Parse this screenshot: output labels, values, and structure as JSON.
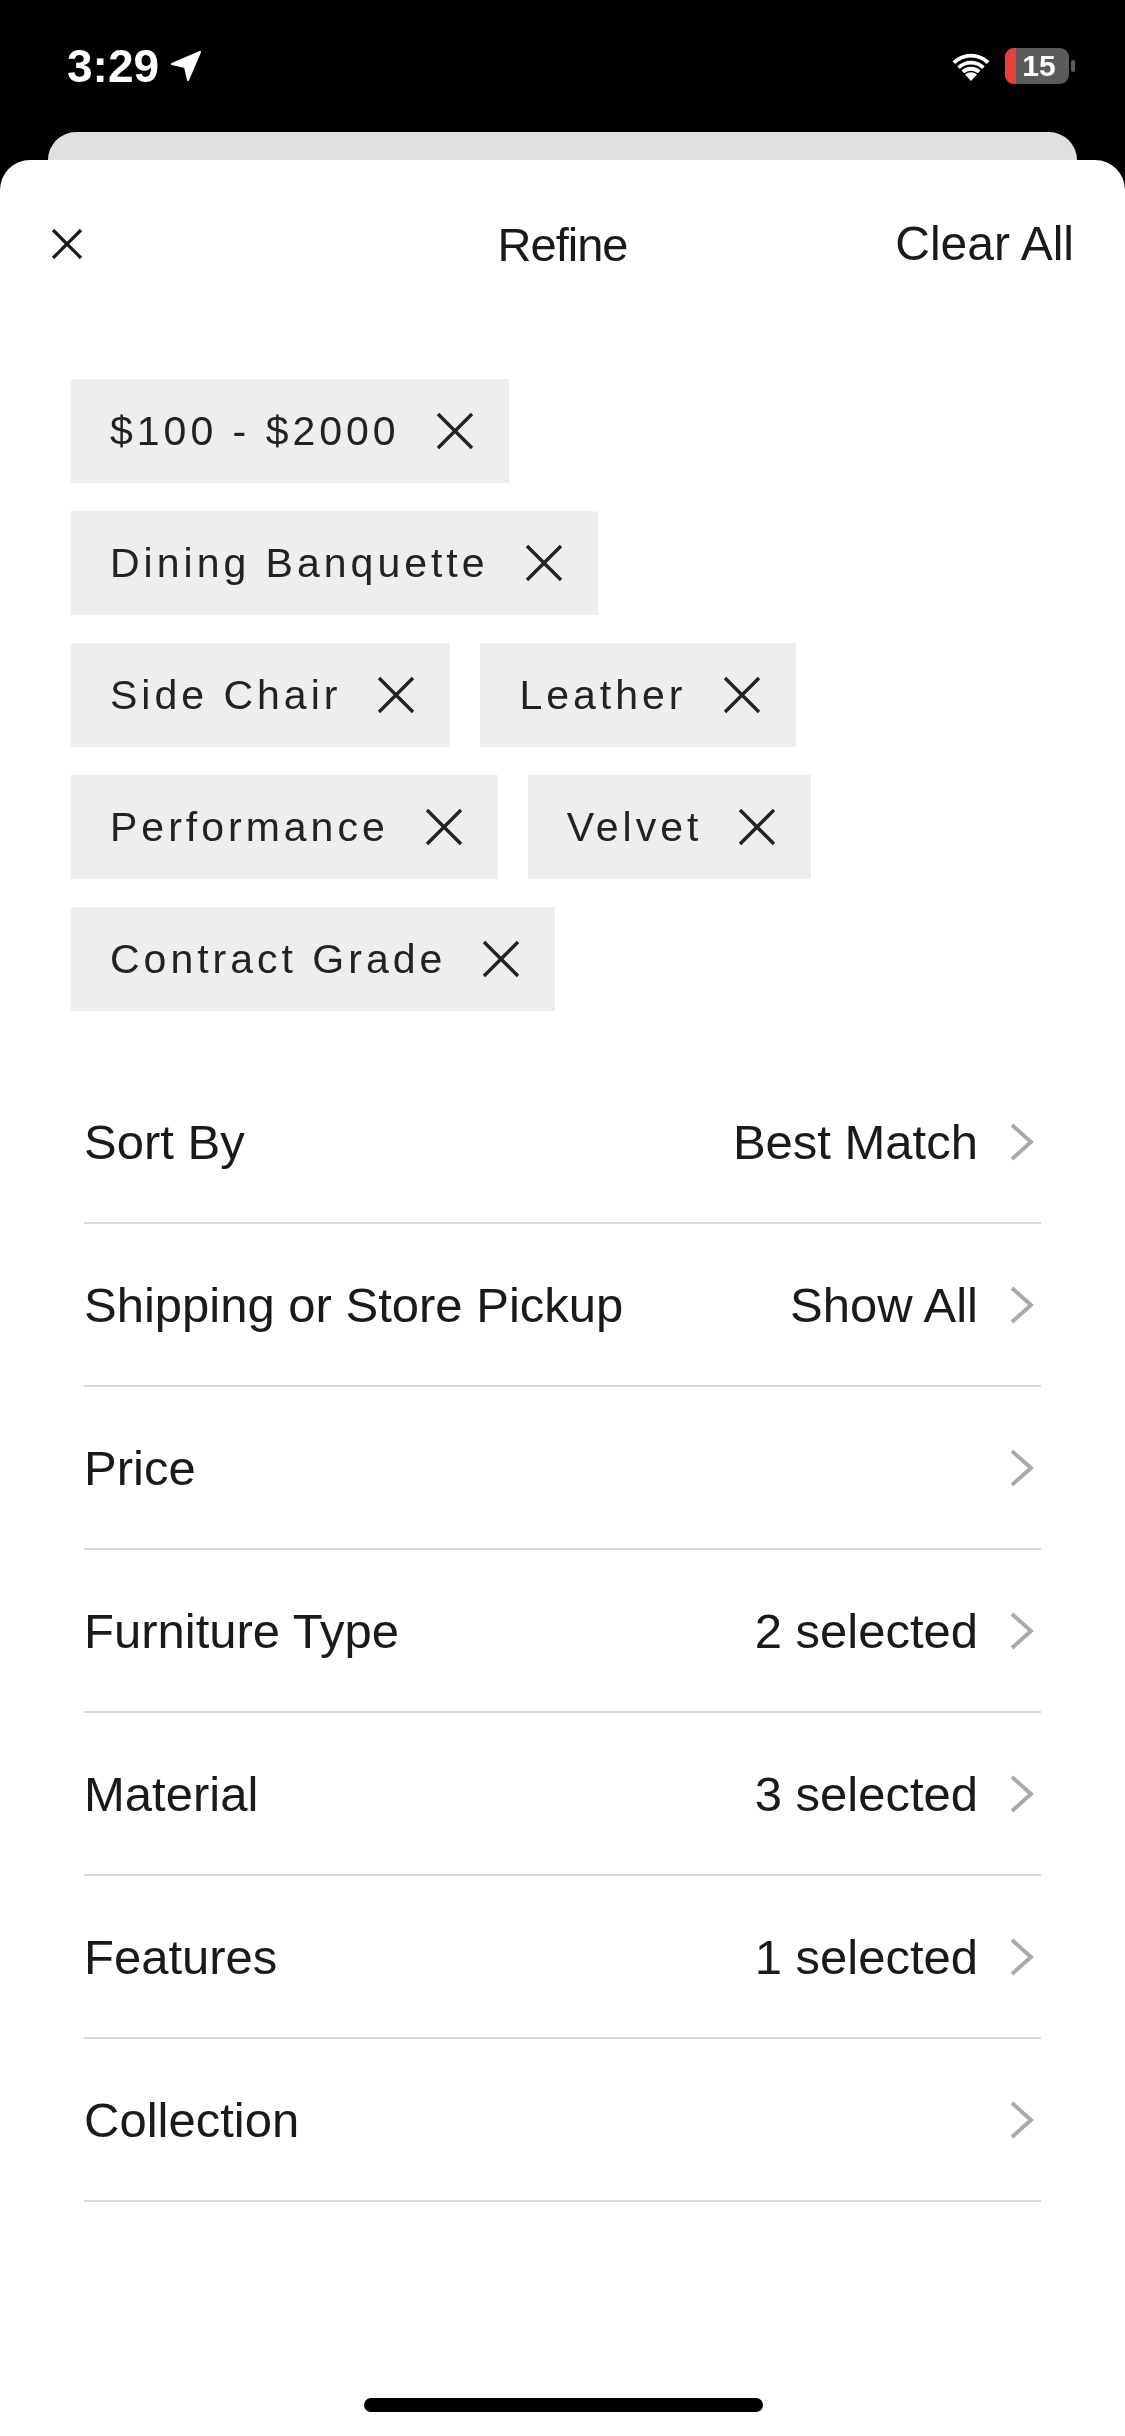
{
  "status_bar": {
    "time": "3:29",
    "battery": "15"
  },
  "header": {
    "title": "Refine",
    "action": "Clear All"
  },
  "chips": [
    "$100 - $2000",
    "Dining Banquette",
    "Side Chair",
    "Leather",
    "Performance",
    "Velvet",
    "Contract Grade"
  ],
  "filters": [
    {
      "label": "Sort By",
      "value": "Best Match"
    },
    {
      "label": "Shipping or Store Pickup",
      "value": "Show All"
    },
    {
      "label": "Price"
    },
    {
      "label": "Furniture Type",
      "value": "2 selected"
    },
    {
      "label": "Material",
      "value": "3 selected"
    },
    {
      "label": "Features",
      "value": "1 selected"
    },
    {
      "label": "Collection"
    }
  ]
}
